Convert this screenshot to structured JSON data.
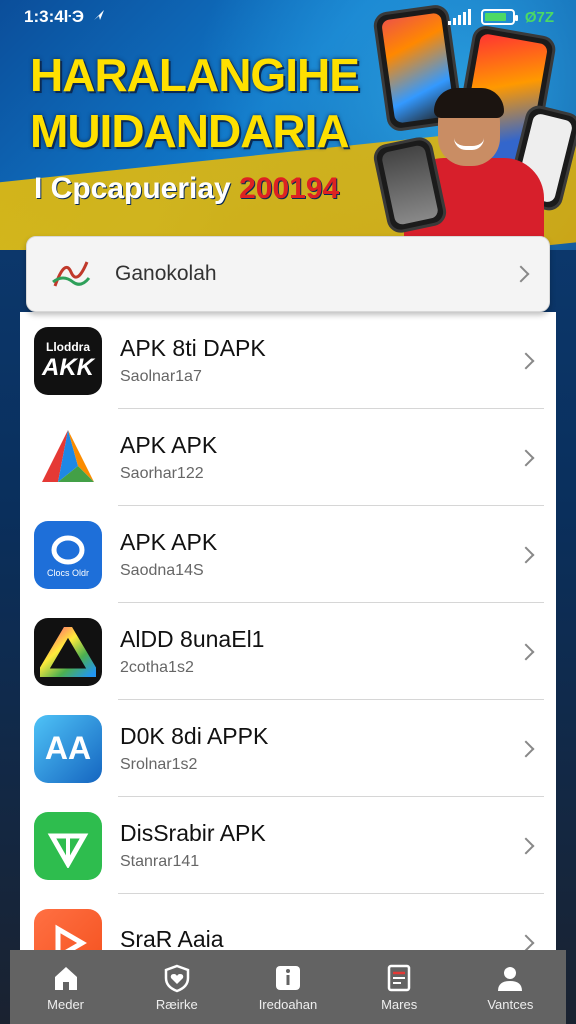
{
  "status_bar": {
    "time": "1:3:4ŀЭ",
    "battery_text": "Ø7Z"
  },
  "banner": {
    "title_line1": "HARALANGIHE",
    "title_line2": "MUIDANDARIA",
    "subtitle": "I Cpcapueriay",
    "subtitle_year": "200194"
  },
  "search_card": {
    "label": "Ganokolah"
  },
  "apps": [
    {
      "title": "APK 8ti DAPK",
      "subtitle": "Saolnar1a7",
      "icon": "black-apk-icon",
      "icon_text": "AKK",
      "icon_top_text": "Lloddra"
    },
    {
      "title": "APK APK",
      "subtitle": "Saorhar122",
      "icon": "triangle-prism-icon"
    },
    {
      "title": "APK APK",
      "subtitle": "Saodna14S",
      "icon": "blue-ring-icon",
      "icon_text": "Clocs Oldr"
    },
    {
      "title": "AlDD 8unaEl1",
      "subtitle": "2cotha1s2",
      "icon": "rainbow-triangle-icon"
    },
    {
      "title": "D0K 8di APPK",
      "subtitle": "Srolnar1s2",
      "icon": "blue-aa-icon",
      "icon_text": "AA"
    },
    {
      "title": "DisSrabir APK",
      "subtitle": "Stanrar141",
      "icon": "green-shield-icon"
    },
    {
      "title": "SraR Aaia",
      "subtitle": "",
      "icon": "orange-play-icon"
    }
  ],
  "bottom_nav": [
    {
      "label": "Meder",
      "icon": "home-icon"
    },
    {
      "label": "Ræirke",
      "icon": "heart-shield-icon"
    },
    {
      "label": "Iredoahan",
      "icon": "info-icon"
    },
    {
      "label": "Mares",
      "icon": "document-icon"
    },
    {
      "label": "Vantces",
      "icon": "person-icon"
    }
  ],
  "colors": {
    "banner_yellow": "#ffe000",
    "banner_blue": "#1077c8",
    "nav_bg": "#636363"
  }
}
